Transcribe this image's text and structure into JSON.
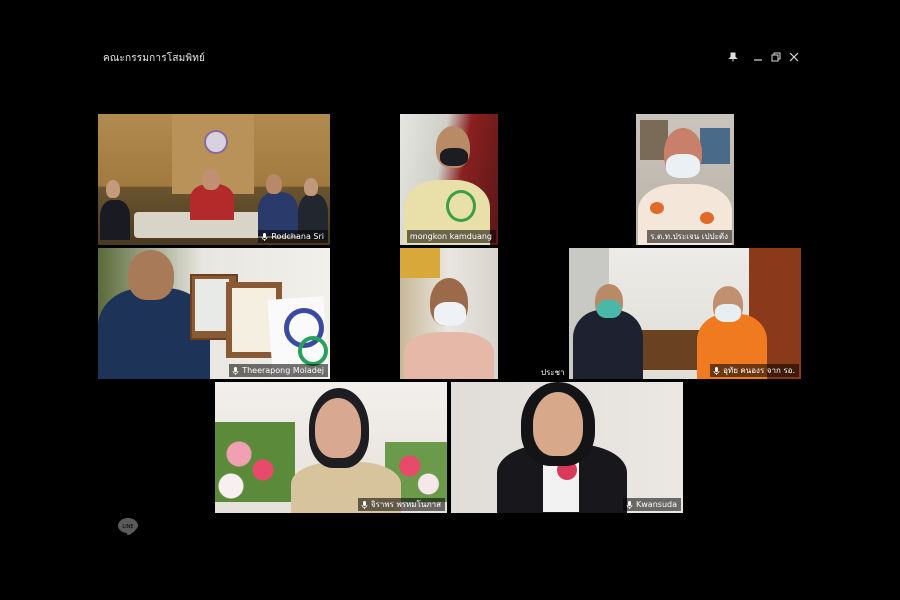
{
  "window": {
    "title": "คณะกรรมการโสมพิทย์",
    "controls": [
      "pin-icon",
      "minimize-icon",
      "restore-icon",
      "close-icon"
    ]
  },
  "participants": [
    {
      "name": "Rodchana Sri",
      "mic": "on",
      "active": true
    },
    {
      "name": "mongkon  kamduang",
      "mic": "none",
      "active": false
    },
    {
      "name": "ร.ต.ท.ประเจน เปปะตัง",
      "mic": "none",
      "active": false
    },
    {
      "name": "Theerapong Moladej",
      "mic": "on",
      "active": false
    },
    {
      "name": "ประชา",
      "mic": "none",
      "active": false
    },
    {
      "name": "อุทัย คนองร จาก รอ.",
      "mic": "on",
      "active": false
    },
    {
      "name": "จิราพร พรหมโนภาส",
      "mic": "on",
      "active": false
    },
    {
      "name": "Kwansuda",
      "mic": "on",
      "active": false
    }
  ],
  "colors": {
    "active_border": "#22c55e",
    "background": "#000000"
  },
  "logo": "line-logo"
}
